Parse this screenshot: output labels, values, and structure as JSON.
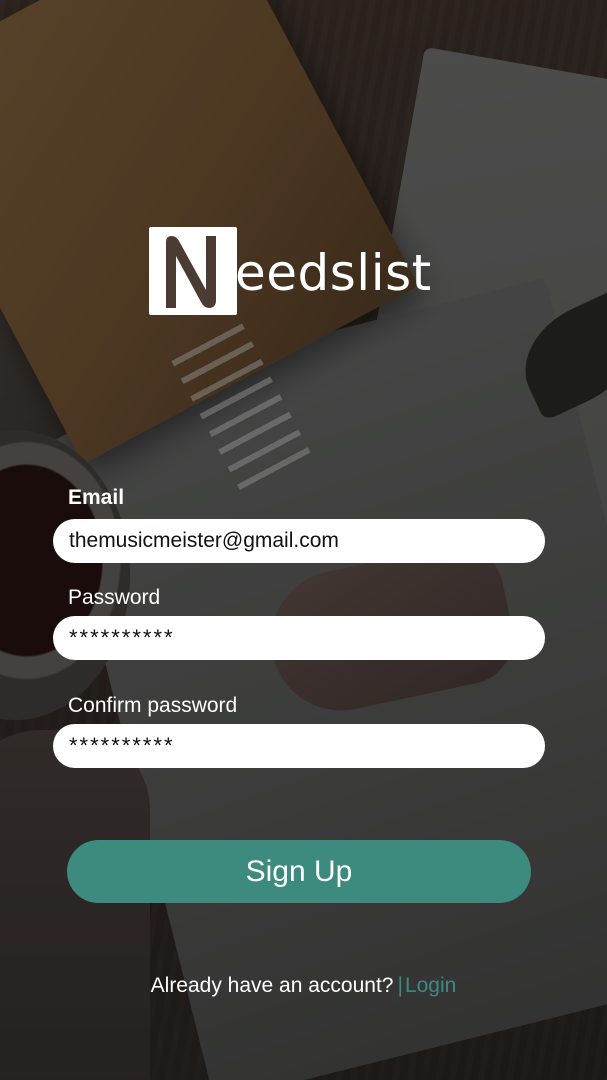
{
  "brand": {
    "name_rest": "eedslist",
    "logo_letter": "N"
  },
  "form": {
    "email_label": "Email",
    "email_value": "themusicmeister@gmail.com",
    "password_label": "Password",
    "password_value": "**********",
    "confirm_label": "Confirm password",
    "confirm_value": "**********"
  },
  "actions": {
    "signup_label": "Sign Up"
  },
  "footer": {
    "prompt": "Already have an account?",
    "separator": "|",
    "login_label": "Login"
  },
  "colors": {
    "accent": "#3d8a7f",
    "field_bg": "#ffffff",
    "text_light": "#ffffff"
  }
}
